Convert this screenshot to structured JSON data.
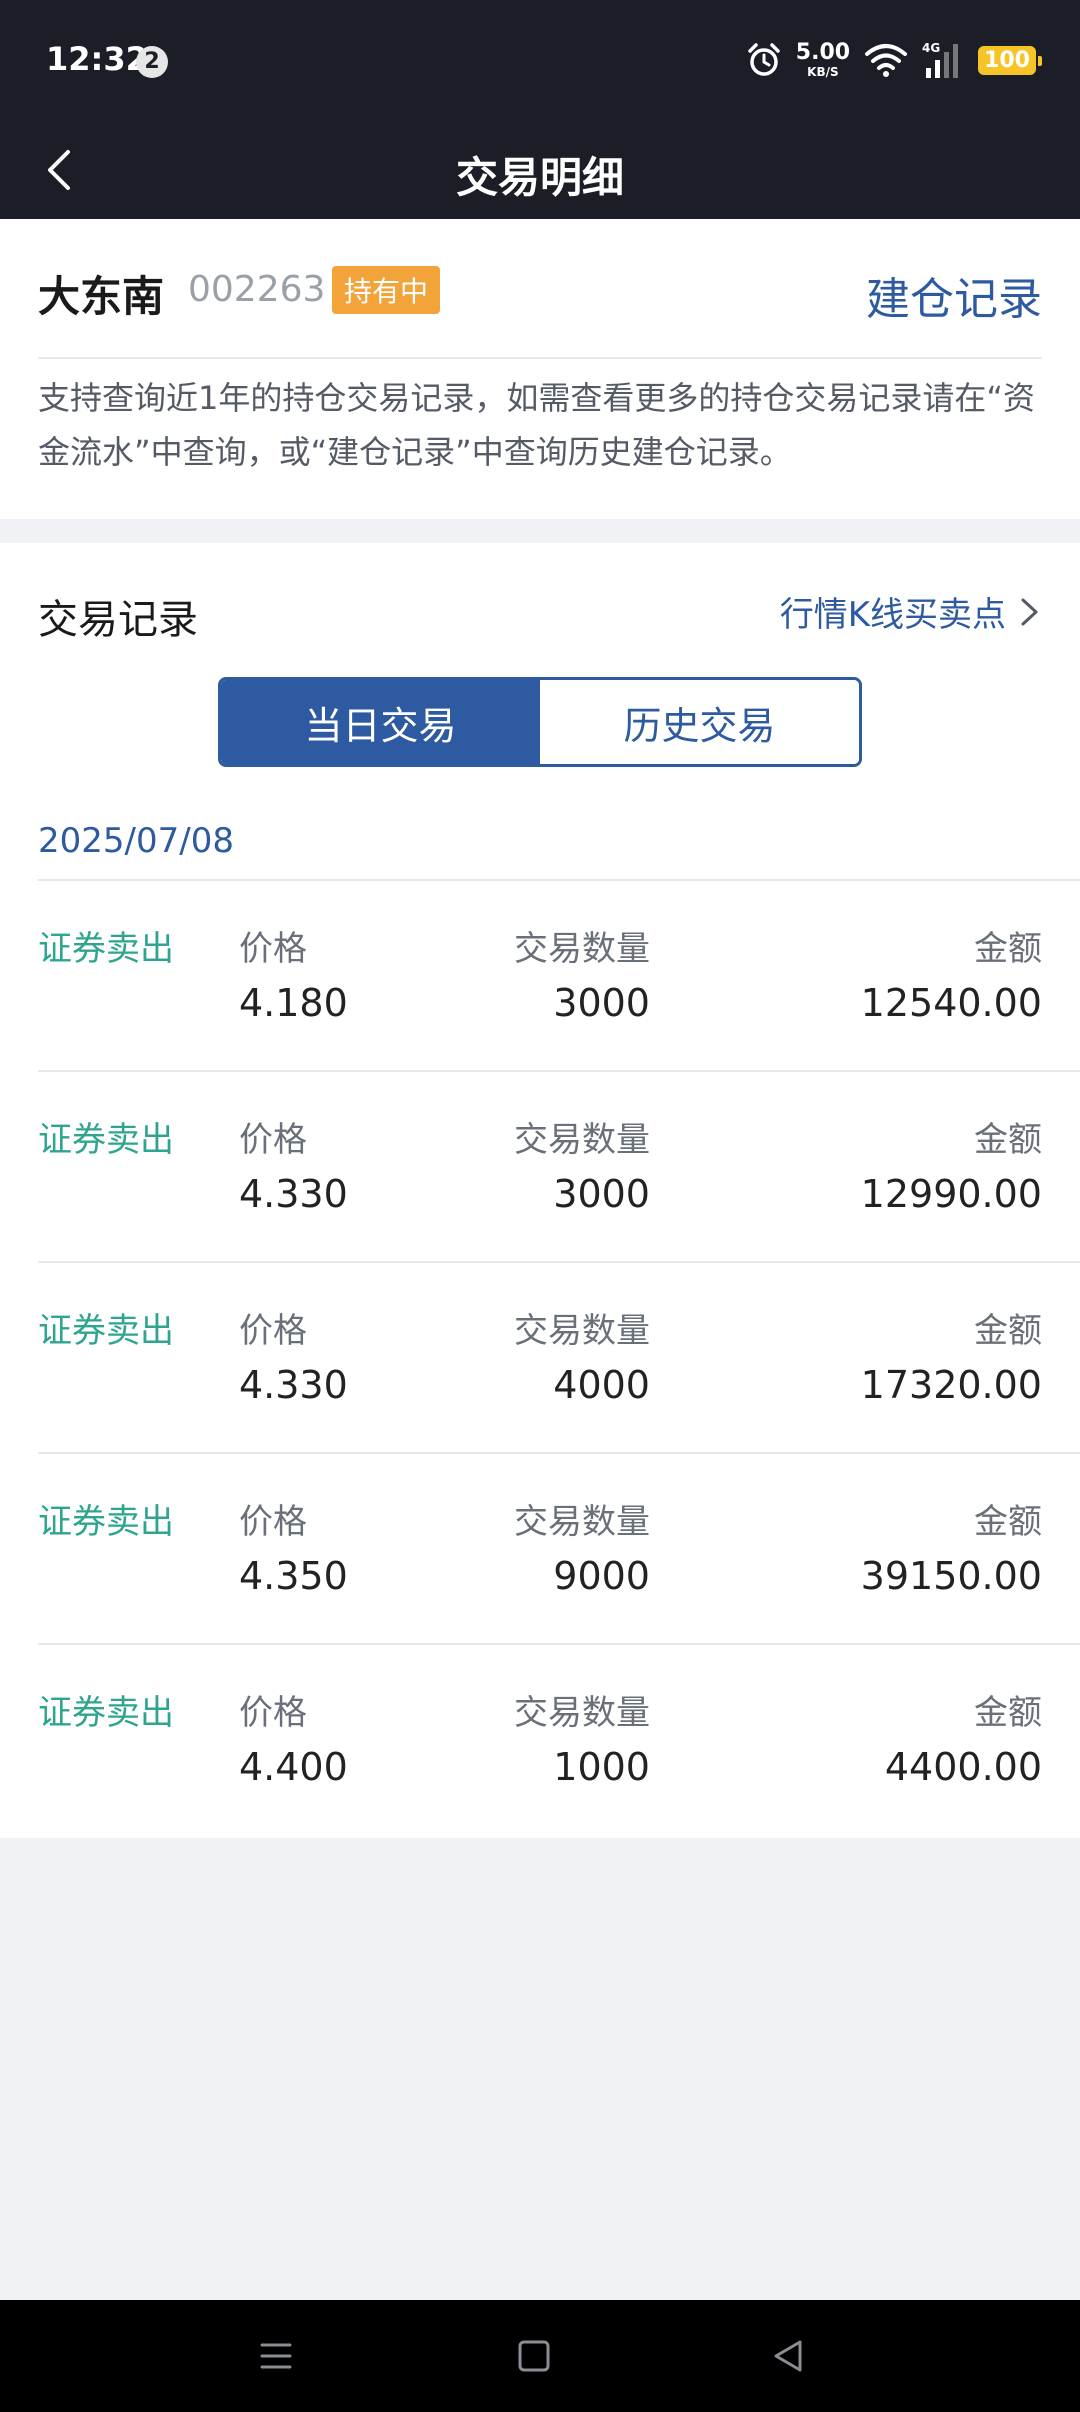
{
  "status_bar": {
    "time": "12:32",
    "notification_count": "2",
    "net_speed_value": "5.00",
    "net_speed_unit": "KB/S",
    "network_type": "4G",
    "battery": "100",
    "icons": [
      "alarm-icon",
      "wifi-icon",
      "signal-icon",
      "battery-icon"
    ]
  },
  "nav": {
    "title": "交易明细",
    "back_icon": "chevron-left-icon"
  },
  "stock": {
    "name": "大东南",
    "code": "002263",
    "status_badge": "持有中",
    "build_record_link": "建仓记录",
    "notice": "支持查询近1年的持仓交易记录，如需查看更多的持仓交易记录请在“资金流水”中查询，或“建仓记录”中查询历史建仓记录。"
  },
  "records": {
    "title": "交易记录",
    "kline_link": "行情K线买卖点",
    "tabs": [
      {
        "label": "当日交易",
        "active": true
      },
      {
        "label": "历史交易",
        "active": false
      }
    ],
    "date": "2025/07/08",
    "labels": {
      "price": "价格",
      "quantity": "交易数量",
      "amount": "金额"
    },
    "trades": [
      {
        "type": "证券卖出",
        "price": "4.180",
        "quantity": "3000",
        "amount": "12540.00"
      },
      {
        "type": "证券卖出",
        "price": "4.330",
        "quantity": "3000",
        "amount": "12990.00"
      },
      {
        "type": "证券卖出",
        "price": "4.330",
        "quantity": "4000",
        "amount": "17320.00"
      },
      {
        "type": "证券卖出",
        "price": "4.350",
        "quantity": "9000",
        "amount": "39150.00"
      },
      {
        "type": "证券卖出",
        "price": "4.400",
        "quantity": "1000",
        "amount": "4400.00"
      }
    ]
  },
  "system_nav": [
    "menu-icon",
    "home-icon",
    "back-icon"
  ],
  "colors": {
    "header_bg": "#1b1e27",
    "accent_blue": "#2d5aa0",
    "sell_green": "#2fa48e",
    "badge_orange": "#f2a43a",
    "battery_yellow": "#f6c427"
  }
}
